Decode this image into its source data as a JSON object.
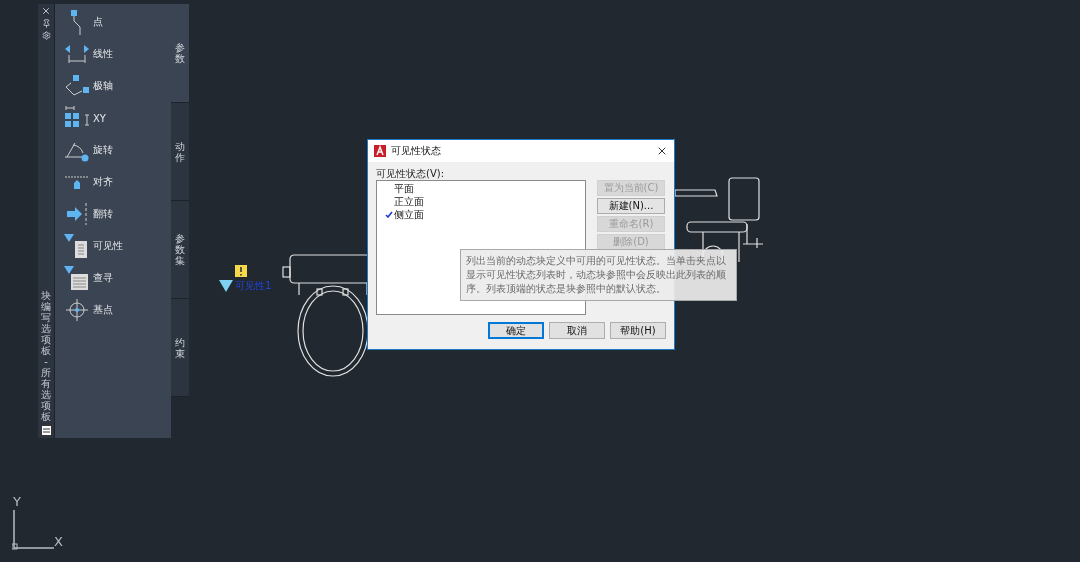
{
  "palette": {
    "title": "块编写选项板 - 所有选项板",
    "tools": [
      {
        "kind": "point",
        "label": "点"
      },
      {
        "kind": "linear",
        "label": "线性"
      },
      {
        "kind": "polar",
        "label": "极轴"
      },
      {
        "kind": "xy",
        "label": "XY"
      },
      {
        "kind": "rotate",
        "label": "旋转"
      },
      {
        "kind": "align",
        "label": "对齐"
      },
      {
        "kind": "flip",
        "label": "翻转"
      },
      {
        "kind": "visibility",
        "label": "可见性"
      },
      {
        "kind": "lookup",
        "label": "查寻"
      },
      {
        "kind": "basepoint",
        "label": "基点"
      }
    ],
    "tabs": [
      {
        "label": "参数",
        "selected": true
      },
      {
        "label": "动作",
        "selected": false
      },
      {
        "label": "参数集",
        "selected": false
      },
      {
        "label": "约束",
        "selected": false
      }
    ]
  },
  "canvas": {
    "parameter_label": "可见性1",
    "ucs": {
      "y": "Y",
      "x": "X"
    }
  },
  "dialog": {
    "title": "可见性状态",
    "list_label": "可见性状态(V):",
    "states": [
      {
        "label": "平面",
        "current": false
      },
      {
        "label": "正立面",
        "current": false
      },
      {
        "label": "侧立面",
        "current": true
      }
    ],
    "side_buttons": [
      {
        "label": "置为当前(C)",
        "disabled": true
      },
      {
        "label": "新建(N)...",
        "disabled": false
      },
      {
        "label": "重命名(R)",
        "disabled": true
      },
      {
        "label": "删除(D)",
        "disabled": true
      }
    ],
    "tooltip": "列出当前的动态块定义中可用的可见性状态。当单击夹点以显示可见性状态列表时，动态块参照中会反映出此列表的顺序。列表顶端的状态是块参照中的默认状态。",
    "footer_buttons": [
      {
        "label": "确定",
        "default": true
      },
      {
        "label": "取消",
        "default": false
      },
      {
        "label": "帮助(H)",
        "default": false
      }
    ]
  }
}
